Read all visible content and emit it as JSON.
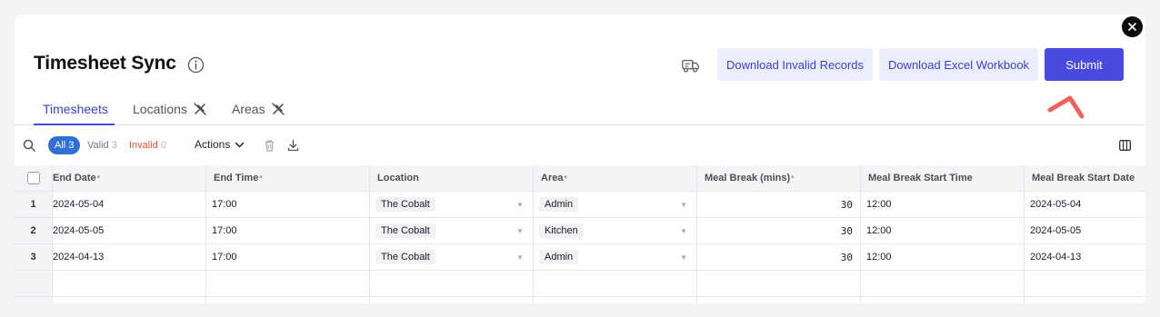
{
  "header": {
    "title": "Timesheet Sync",
    "download_invalid_label": "Download Invalid Records",
    "download_excel_label": "Download Excel Workbook",
    "submit_label": "Submit"
  },
  "tabs": [
    {
      "label": "Timesheets",
      "active": true
    },
    {
      "label": "Locations",
      "active": false
    },
    {
      "label": "Areas",
      "active": false
    }
  ],
  "toolbar": {
    "filter_all_label": "All",
    "filter_all_count": "3",
    "filter_valid_label": "Valid",
    "filter_valid_count": "3",
    "filter_invalid_label": "Invalid",
    "filter_invalid_count": "0",
    "actions_label": "Actions"
  },
  "table": {
    "columns": [
      {
        "label": "End Date",
        "required": "*"
      },
      {
        "label": "End Time",
        "required": "*"
      },
      {
        "label": "Location",
        "required": ""
      },
      {
        "label": "Area",
        "required": "*"
      },
      {
        "label": "Meal Break (mins)",
        "required": "*"
      },
      {
        "label": "Meal Break Start Time",
        "required": ""
      },
      {
        "label": "Meal Break Start Date",
        "required": ""
      }
    ],
    "rows": [
      {
        "num": "1",
        "end_date": "2024-05-04",
        "end_time": "17:00",
        "location": "The Cobalt",
        "area": "Admin",
        "meal_break": "30",
        "meal_start_time": "12:00",
        "meal_start_date": "2024-05-04"
      },
      {
        "num": "2",
        "end_date": "2024-05-05",
        "end_time": "17:00",
        "location": "The Cobalt",
        "area": "Kitchen",
        "meal_break": "30",
        "meal_start_time": "12:00",
        "meal_start_date": "2024-05-05"
      },
      {
        "num": "3",
        "end_date": "2024-04-13",
        "end_time": "17:00",
        "location": "The Cobalt",
        "area": "Admin",
        "meal_break": "30",
        "meal_start_time": "12:00",
        "meal_start_date": "2024-04-13"
      }
    ]
  },
  "colors": {
    "accent": "#4a4ae0",
    "accent_light": "#eceefd",
    "filter_all": "#2f6fd6",
    "invalid": "#d85a3a"
  }
}
